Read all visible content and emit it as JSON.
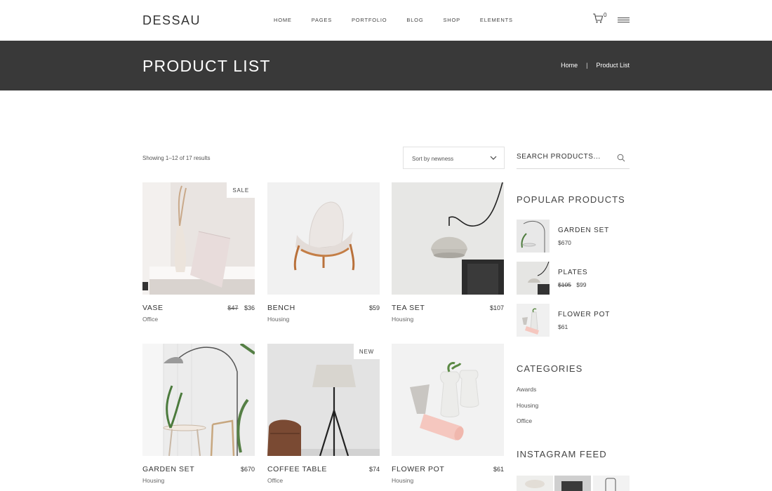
{
  "header": {
    "logo": "DESSAU",
    "nav": [
      "HOME",
      "PAGES",
      "PORTFOLIO",
      "BLOG",
      "SHOP",
      "ELEMENTS"
    ],
    "cart_count": "0",
    "icons": [
      "cart-icon",
      "menu-icon"
    ]
  },
  "titlebar": {
    "title": "PRODUCT LIST",
    "breadcrumb": [
      "Home",
      "Product List"
    ],
    "separator": "|"
  },
  "toolbar": {
    "results": "Showing 1–12 of 17 results",
    "sort": "Sort by newness"
  },
  "products": [
    {
      "name": "VASE",
      "old_price": "$47",
      "price": "$36",
      "category": "Office",
      "badge": "SALE"
    },
    {
      "name": "BENCH",
      "price": "$59",
      "category": "Housing"
    },
    {
      "name": "TEA SET",
      "price": "$107",
      "category": "Housing"
    },
    {
      "name": "GARDEN SET",
      "price": "$670",
      "category": "Housing"
    },
    {
      "name": "COFFEE TABLE",
      "price": "$74",
      "category": "Office",
      "badge": "NEW"
    },
    {
      "name": "FLOWER POT",
      "price": "$61",
      "category": "Housing"
    }
  ],
  "sidebar": {
    "search_placeholder": "SEARCH PRODUCTS...",
    "popular_heading": "POPULAR PRODUCTS",
    "popular": [
      {
        "name": "GARDEN SET",
        "price": "$670"
      },
      {
        "name": "PLATES",
        "old_price": "$105",
        "price": "$99"
      },
      {
        "name": "FLOWER POT",
        "price": "$61"
      }
    ],
    "categories_heading": "CATEGORIES",
    "categories": [
      "Awards",
      "Housing",
      "Office"
    ],
    "instagram_heading": "INSTAGRAM FEED"
  },
  "colors": {
    "titlebar_bg": "#393939",
    "text": "#333333",
    "border": "#e2e2e2"
  }
}
